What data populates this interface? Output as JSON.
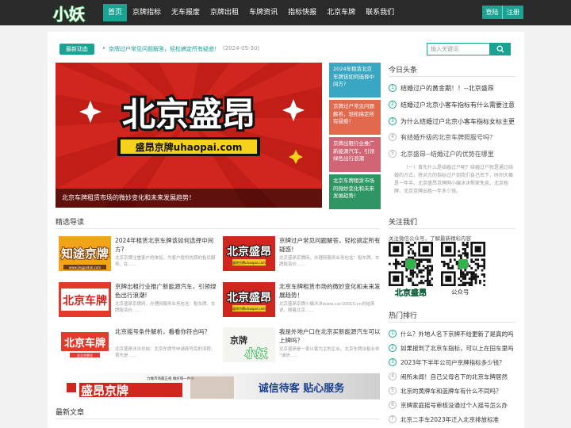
{
  "nav": {
    "logo_text": "小妖",
    "items": [
      {
        "label": "首页",
        "active": true
      },
      {
        "label": "京牌指标",
        "active": false
      },
      {
        "label": "无车报废",
        "active": false
      },
      {
        "label": "京牌出租",
        "active": false
      },
      {
        "label": "车牌资讯",
        "active": false
      },
      {
        "label": "指标快报",
        "active": false
      },
      {
        "label": "北京车牌",
        "active": false
      },
      {
        "label": "联系我们",
        "active": false
      }
    ],
    "login": "登陆",
    "register": "注册"
  },
  "ticker": {
    "badge": "最新动态",
    "text": "京牌过户常见问题解答，轻松搞定所有疑惑！",
    "date": "(2024-05-30)"
  },
  "search": {
    "placeholder": "输入关键词"
  },
  "hero": {
    "brand_big": "北京盛昂",
    "brand_small": "盛昂京牌uhaopai.com",
    "caption": "北京车牌租赁市场的微妙变化和未来发展趋势！"
  },
  "side_cards": [
    "2024年租赁北京车牌该如何选择中间方?",
    "京牌过户常见问题解答，轻松搞定所有疑惑！",
    "京牌出租行业推广新能源汽车，引领绿色出行浪潮",
    "北京车牌租赁市场的微妙变化和未来发展趋势！"
  ],
  "headlines": {
    "title": "今日头条",
    "items": [
      {
        "num": "1",
        "text": "结婚过户的黄金期！！--北京盛昂"
      },
      {
        "num": "2",
        "text": "结婚过户北京小客车指标有什么需要注意"
      },
      {
        "num": "3",
        "text": "为什么结婚过户北京小客车指标女标主更"
      },
      {
        "num": "4",
        "text": "有结婚升级的北京车牌照服号吗？"
      },
      {
        "num": "5",
        "text": "北京盛昂--结婚过户的优势在哪里"
      }
    ],
    "summary": "（一）首先什么是结婚过户呢？结婚过户就是通过结婚的方式，将对方的指标过户到我们自己名下，时间大概是一年半。北京盛昂京牌网小编沐沐帮家免息，北京租牌、北京京牌出租一年多少钱。"
  },
  "featured": {
    "title": "精选导读",
    "items": [
      {
        "title": "2024年租赁北京车牌该如何选择中间方?",
        "desc": "北京京牌注重客户的体验，为客户提供优质的售后服务。在……",
        "thumb": "知途京牌",
        "thumb_small": "www.jingpaituk.com"
      },
      {
        "title": "京牌过户常见问题解答，轻松搞定所有疑惑！",
        "desc": "北京盛昂京牌网，办理网服务业务包含：租车牌、车牌租赁价……",
        "thumb": "北京盛昂",
        "thumb_small": "盛昂京牌uhaopai.com"
      },
      {
        "title": "京牌出租行业推广新能源汽车，引领绿色出行浪潮!",
        "desc": "北京盛昂京牌网，办理网服务业务包含：租车牌、车牌租赁价……",
        "thumb": "北京车牌",
        "thumb_small": ""
      },
      {
        "title": "北京车牌租赁市场的微妙变化和未来发展趋势！",
        "desc": "北京盛昂京牌小编沐沐www.car10010.cn总结来说，随着北京……",
        "thumb": "北京盛昂",
        "thumb_small": "盛昂京牌uhaopai.com"
      },
      {
        "title": "北京摇号条件解析，看看你符合吗？",
        "desc": "北京盛昂沐沐总结：北京车牌号申请既号后的流程，首先是……",
        "thumb": "北京车牌",
        "thumb_small": "关注京牌号"
      },
      {
        "title": "我是外地户口在北京买新能源汽车可以上牌吗？",
        "desc": "北京盛昂是一家以客为主的企业。北京车牌出租业务 “诚信……",
        "thumb": "京牌小妖",
        "thumb_small": ""
      }
    ]
  },
  "banner": {
    "brand": "盛昂京牌",
    "slogan": "诚信待客  贴心服务",
    "note": "力做市场最正规 做好每一件事"
  },
  "latest_articles": {
    "title": "最新文章"
  },
  "follow": {
    "title": "关注我们",
    "text": "关注微信公众号，了解最新精彩内容",
    "qr_caption_left": "北京盛昂",
    "qr_caption_right": "公众号"
  },
  "hot": {
    "title": "热门排行",
    "items": [
      {
        "num": "1",
        "text": "什么？外地人名下京牌不给更新了是真的吗"
      },
      {
        "num": "2",
        "text": "如果报到了北京车指标，可以上在田车里吗"
      },
      {
        "num": "3",
        "text": "2023年下半年公司户京牌指标多少钱？"
      },
      {
        "num": "4",
        "text": "闹所未闻！自己父母名下的北京车牌居然"
      },
      {
        "num": "5",
        "text": "北京的黄牌车和蓝牌车有什么不同吗？"
      },
      {
        "num": "6",
        "text": "京牌家庭摇号审核没通过个人摇号怎么办"
      },
      {
        "num": "7",
        "text": "北京二手车2023年迁入北京排放标准"
      }
    ]
  },
  "colors": {
    "accent": "#1aa393",
    "nav_bg": "#2a2a2a",
    "hero_red": "#d0261e",
    "yellow": "#f7d21a"
  }
}
